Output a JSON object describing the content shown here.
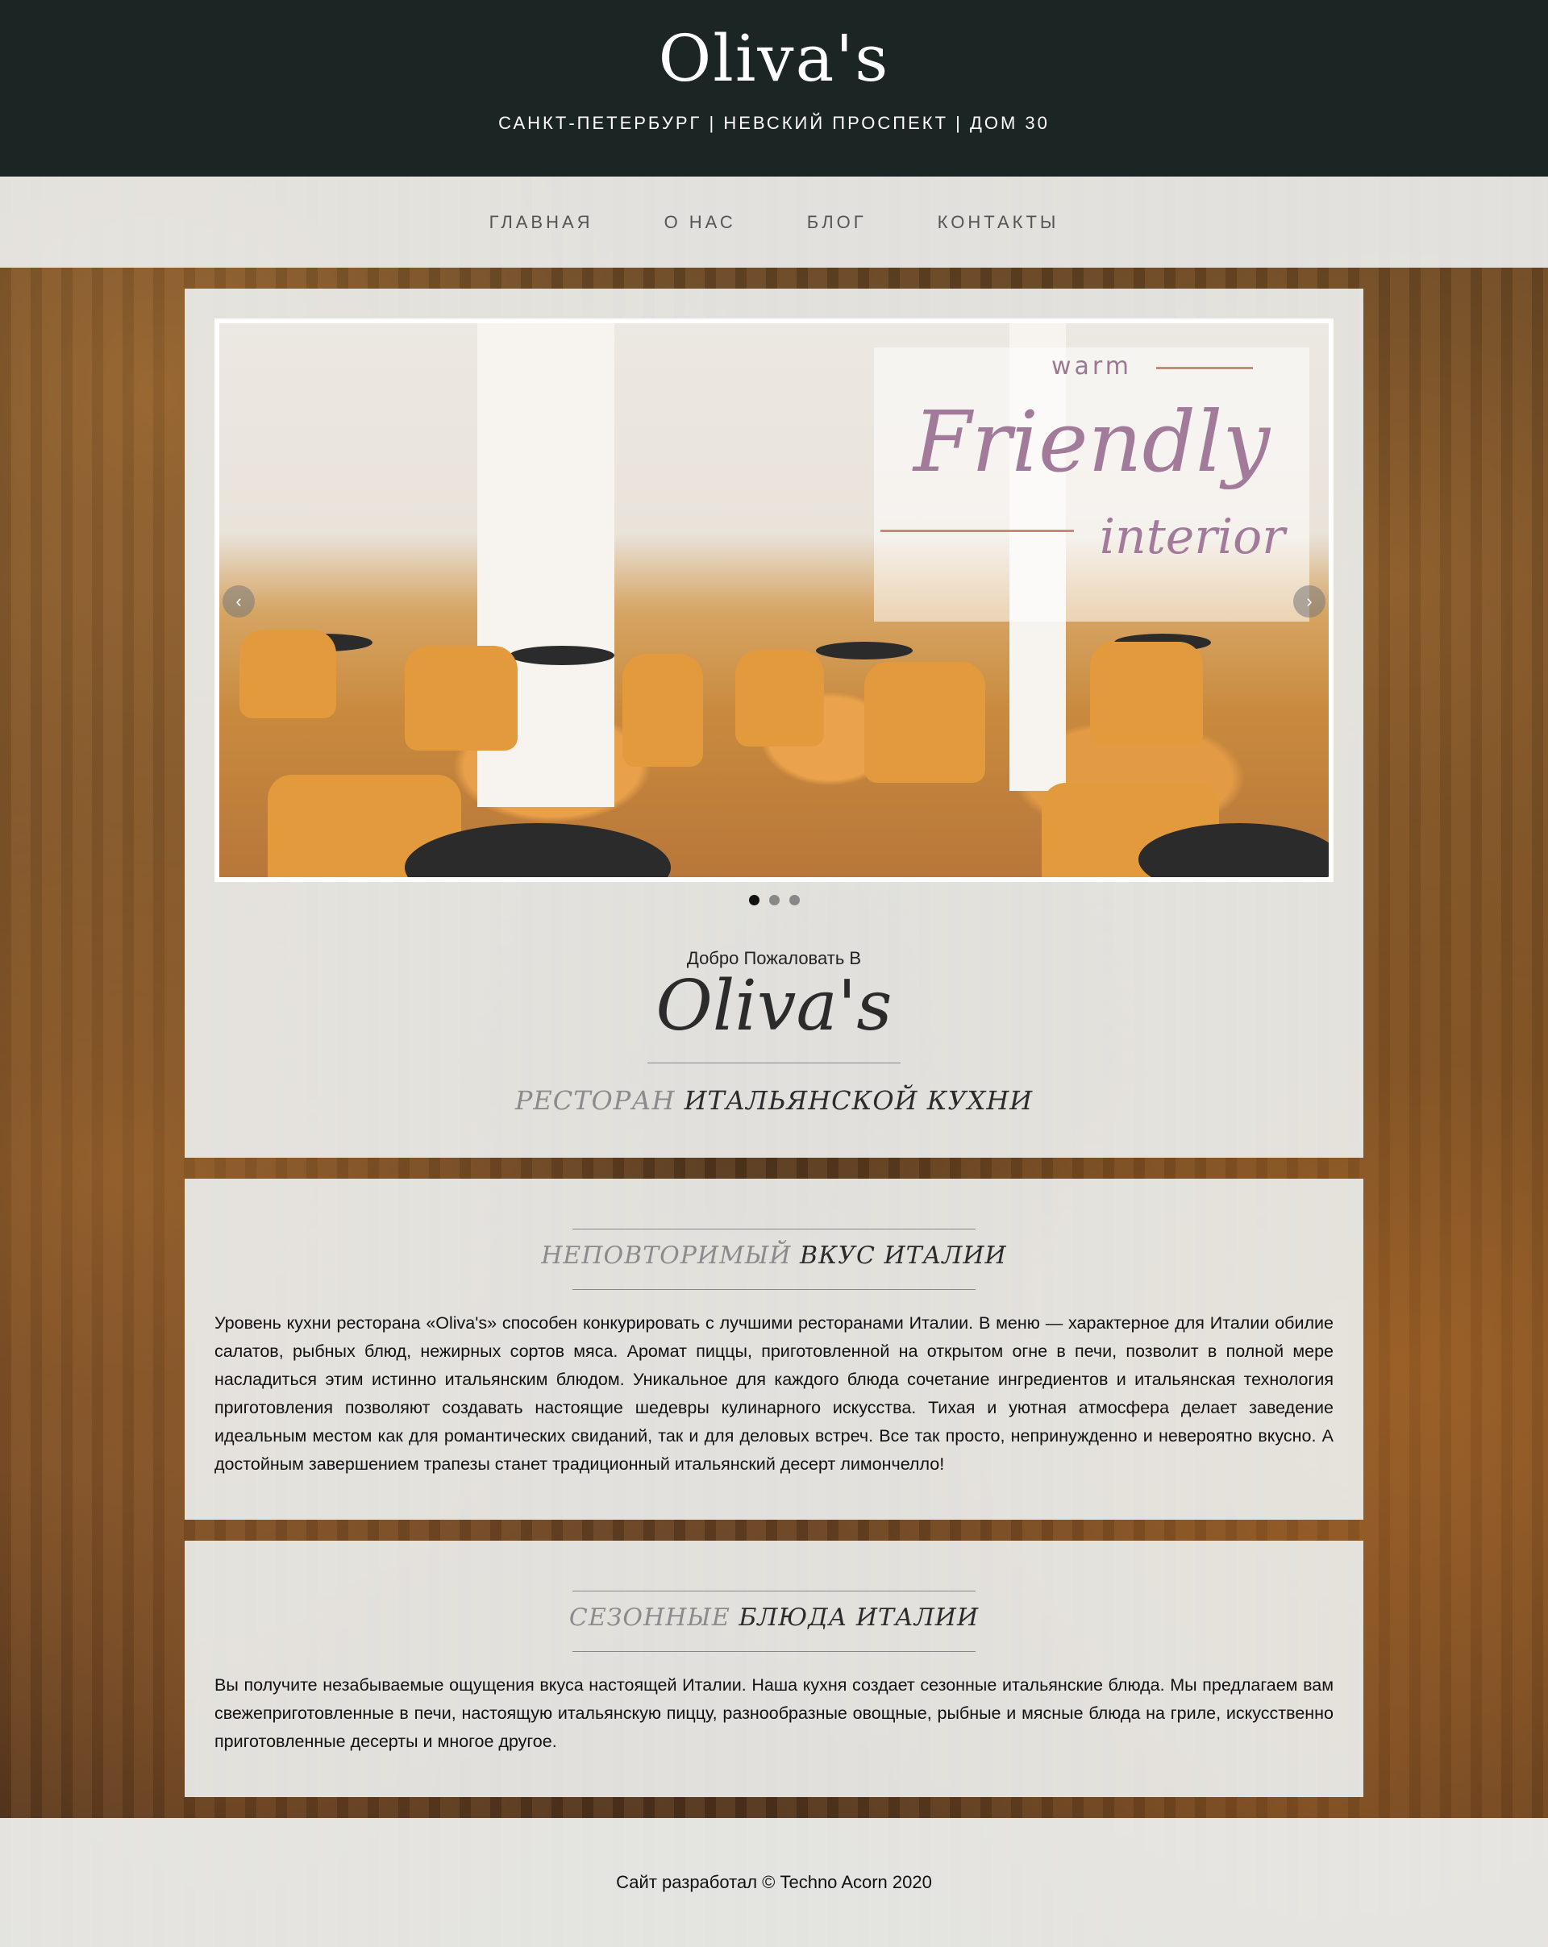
{
  "header": {
    "brand": "Oliva's",
    "address": "САНКТ-ПЕТЕРБУРГ | НЕВСКИЙ ПРОСПЕКТ | ДОМ 30"
  },
  "nav": {
    "items": [
      {
        "label": "ГЛАВНАЯ"
      },
      {
        "label": "О НАС"
      },
      {
        "label": "БЛОГ"
      },
      {
        "label": "КОНТАКТЫ"
      }
    ]
  },
  "slider": {
    "overlay_small": "warm",
    "overlay_big": "Friendly",
    "overlay_tail": "interior",
    "prev_icon": "chevron-left-icon",
    "next_icon": "chevron-right-icon",
    "dots": 3,
    "active_dot": 1
  },
  "welcome": {
    "greeting": "Добро Пожаловать В",
    "name": "Oliva's",
    "subtitle_light": "РЕСТОРАН",
    "subtitle_dark": "ИТАЛЬЯНСКОЙ КУХНИ"
  },
  "section1": {
    "title_light": "НЕПОВТОРИМЫЙ",
    "title_dark": "ВКУС ИТАЛИИ",
    "text": "Уровень кухни ресторана «Oliva's» способен конкурировать с лучшими ресторанами Италии. В меню — характерное для Италии обилие салатов, рыбных блюд, нежирных сортов мяса. Аромат пиццы, приготовленной на открытом огне в печи, позволит в полной мере насладиться этим истинно итальянским блюдом. Уникальное для каждого блюда сочетание ингредиентов и итальянская технология приготовления позволяют создавать настоящие шедевры кулинарного искусства. Тихая и уютная атмосфера делает заведение идеальным местом как для романтических свиданий, так и для деловых встреч. Все так просто, непринужденно и невероятно вкусно. А  достойным завершением трапезы станет традиционный итальянский десерт лимончелло!"
  },
  "section2": {
    "title_light": "СЕЗОННЫЕ",
    "title_dark": "БЛЮДА ИТАЛИИ",
    "text": "Вы получите незабываемые ощущения вкуса настоящей Италии. Наша кухня создает сезонные  итальянские блюда. Мы предлагаем вам свежеприготовленные в печи, настоящую итальянскую пиццу, разнообразные овощные, рыбные и мясные блюда на гриле, искусственно приготовленные десерты и многое другое."
  },
  "footer": {
    "text": "Сайт разработал © Techno Acorn 2020"
  },
  "colors": {
    "header_bg": "#1b2523",
    "panel_bg": "#ecedeb",
    "overlay_text": "#a27b9a"
  }
}
